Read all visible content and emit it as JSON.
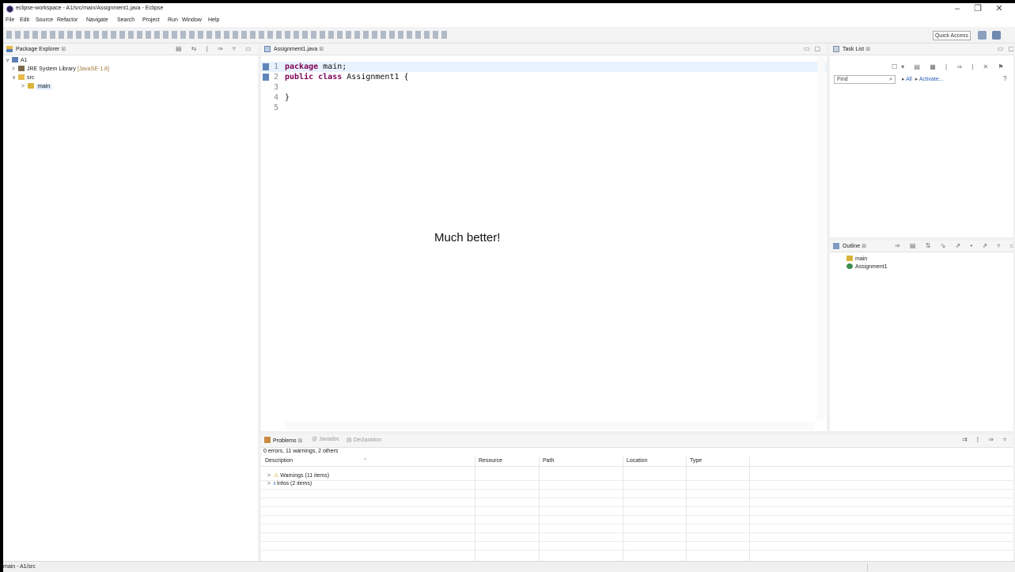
{
  "window": {
    "title": "eclipse-workspace - A1/src/main/Assignment1.java - Eclipse",
    "minimize": "–",
    "maximize": "❐",
    "close": "✕"
  },
  "menu": [
    "File",
    "Edit",
    "Source",
    "Refactor",
    "Navigate",
    "Search",
    "Project",
    "Run",
    "Window",
    "Help"
  ],
  "toolbar": {
    "quick_access": "Quick Access"
  },
  "package_explorer": {
    "title": "Package Explorer",
    "tree": [
      {
        "label": "A1",
        "depth": 0,
        "toggle": "∨"
      },
      {
        "label": "JRE System Library",
        "suffix": "[JavaSE-1.8]",
        "depth": 1,
        "toggle": ">"
      },
      {
        "label": "src",
        "depth": 1,
        "toggle": "∨"
      },
      {
        "label": "main",
        "depth": 2,
        "toggle": ">"
      }
    ]
  },
  "editor": {
    "tab": "Assignment1.java",
    "lines": [
      {
        "num": "1",
        "kw": "package",
        "rest": " main;"
      },
      {
        "num": "2",
        "kw": "public class",
        "rest": " Assignment1 {"
      },
      {
        "num": "3",
        "kw": "",
        "rest": ""
      },
      {
        "num": "4",
        "kw": "",
        "rest": "}"
      },
      {
        "num": "5",
        "kw": "",
        "rest": ""
      }
    ]
  },
  "caption": "Much better!",
  "task_list": {
    "title": "Task List",
    "find_placeholder": "Find",
    "all_label": "All",
    "activate_label": "Activate..."
  },
  "outline": {
    "title": "Outline",
    "items": [
      "main",
      "Assignment1"
    ]
  },
  "problems": {
    "tabs": [
      "Problems",
      "Javadoc",
      "Declaration"
    ],
    "summary": "0 errors, 11 warnings, 2 others",
    "columns": [
      "Description",
      "Resource",
      "Path",
      "Location",
      "Type"
    ],
    "rows": [
      {
        "icon": "warning-icon",
        "label": "Warnings (11 items)"
      },
      {
        "icon": "info-icon",
        "label": "Infos (2 items)"
      }
    ]
  },
  "status": {
    "text": "main - A1/src"
  },
  "colors": {
    "keyword": "#7f0055",
    "current_line": "#e8f2fe",
    "selection": "#dbe9fb",
    "folder": "#e8b94a"
  }
}
